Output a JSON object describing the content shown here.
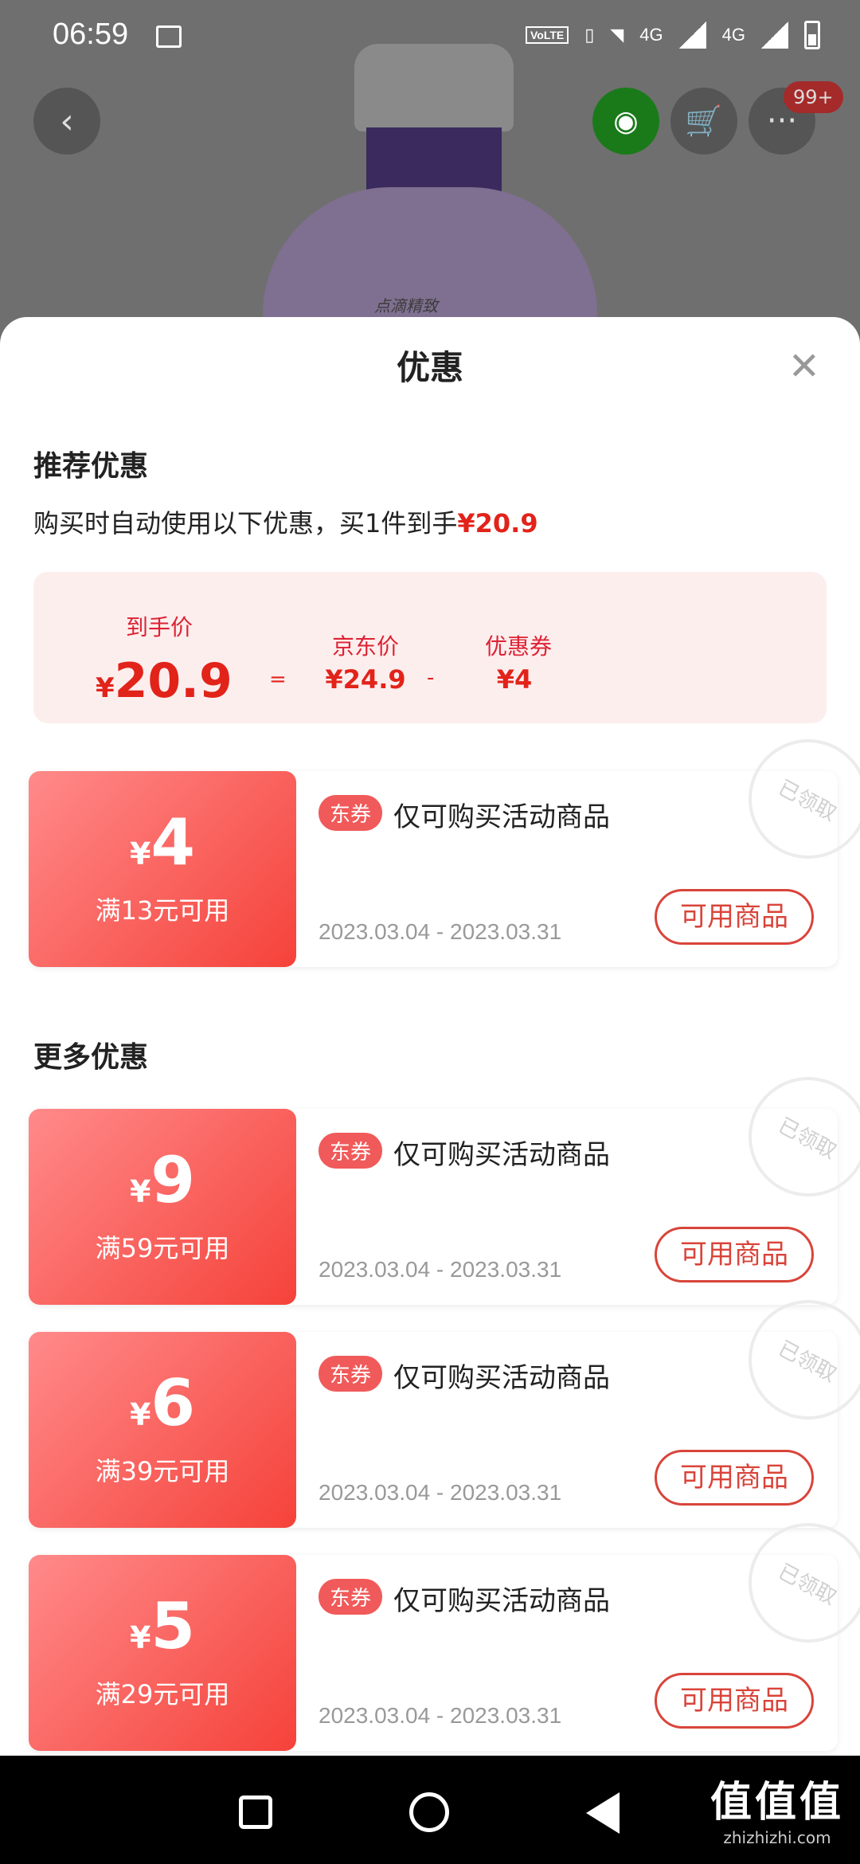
{
  "status_bar": {
    "time": "06:59",
    "net_label": "VoLTE",
    "net_4g_1": "4G",
    "net_4g_2": "4G"
  },
  "topbar": {
    "badge_count": "99+"
  },
  "product": {
    "bottle_text": "点滴精致"
  },
  "sheet": {
    "title": "优惠",
    "recommended": {
      "title": "推荐优惠",
      "desc_prefix": "购买时自动使用以下优惠，买1件到手",
      "desc_price": "¥20.9",
      "final_label": "到手价",
      "final_currency": "¥",
      "final_value": "20.9",
      "eq": "=",
      "jd_label": "京东价",
      "jd_value": "¥24.9",
      "minus": "-",
      "coupon_label": "优惠券",
      "coupon_value": "¥4"
    },
    "more_title": "更多优惠",
    "coupons": [
      {
        "currency": "¥",
        "amount": "4",
        "condition": "满13元可用",
        "tag": "东券",
        "desc": "仅可购买活动商品",
        "date": "2023.03.04 - 2023.03.31",
        "button": "可用商品",
        "stamp": "已领取"
      },
      {
        "currency": "¥",
        "amount": "9",
        "condition": "满59元可用",
        "tag": "东券",
        "desc": "仅可购买活动商品",
        "date": "2023.03.04 - 2023.03.31",
        "button": "可用商品",
        "stamp": "已领取"
      },
      {
        "currency": "¥",
        "amount": "6",
        "condition": "满39元可用",
        "tag": "东券",
        "desc": "仅可购买活动商品",
        "date": "2023.03.04 - 2023.03.31",
        "button": "可用商品",
        "stamp": "已领取"
      },
      {
        "currency": "¥",
        "amount": "5",
        "condition": "满29元可用",
        "tag": "东券",
        "desc": "仅可购买活动商品",
        "date": "2023.03.04 - 2023.03.31",
        "button": "可用商品",
        "stamp": "已领取"
      }
    ]
  },
  "watermark": {
    "main": "值值值",
    "sub": "zhizhizhi.com"
  }
}
